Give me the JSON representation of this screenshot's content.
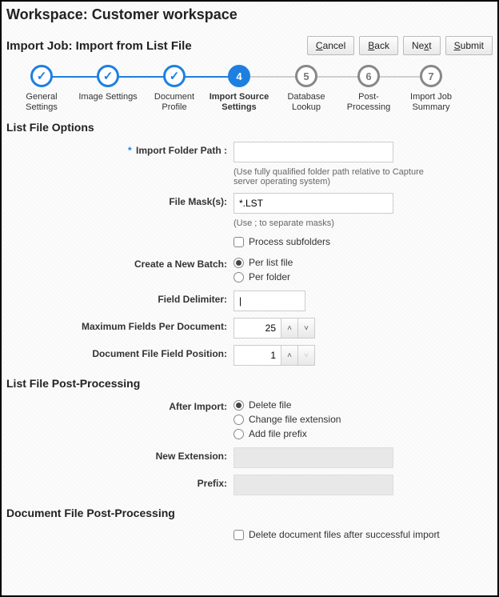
{
  "workspace_title": "Workspace: Customer workspace",
  "job_title": "Import Job: Import from List File",
  "buttons": {
    "cancel": "Cancel",
    "back": "Back",
    "next": "Next",
    "submit": "Submit"
  },
  "steps": [
    {
      "label": "General\nSettings",
      "state": "done"
    },
    {
      "label": "Image Settings",
      "state": "done"
    },
    {
      "label": "Document\nProfile",
      "state": "done"
    },
    {
      "num": "4",
      "label": "Import Source\nSettings",
      "state": "current"
    },
    {
      "num": "5",
      "label": "Database\nLookup",
      "state": "future"
    },
    {
      "num": "6",
      "label": "Post-\nProcessing",
      "state": "future"
    },
    {
      "num": "7",
      "label": "Import Job\nSummary",
      "state": "future"
    }
  ],
  "sections": {
    "listFileOptions": "List File Options",
    "listFilePost": "List File Post-Processing",
    "docFilePost": "Document File Post-Processing"
  },
  "form": {
    "importFolderPath": {
      "label": "Import Folder Path :",
      "value": "",
      "hint": "(Use fully qualified folder path relative to Capture server operating system)"
    },
    "fileMasks": {
      "label": "File Mask(s):",
      "value": "*.LST",
      "hint": "(Use ; to separate masks)"
    },
    "processSubfolders": {
      "label": "Process subfolders",
      "checked": false
    },
    "createNewBatch": {
      "label": "Create a New Batch:",
      "options": [
        "Per list file",
        "Per folder"
      ],
      "selected": 0
    },
    "fieldDelimiter": {
      "label": "Field Delimiter:",
      "value": "|"
    },
    "maxFields": {
      "label": "Maximum Fields Per Document:",
      "value": "25"
    },
    "docFieldPos": {
      "label": "Document File Field Position:",
      "value": "1"
    },
    "afterImport": {
      "label": "After Import:",
      "options": [
        "Delete file",
        "Change file extension",
        "Add file prefix"
      ],
      "selected": 0
    },
    "newExtension": {
      "label": "New Extension:",
      "value": ""
    },
    "prefix": {
      "label": "Prefix:",
      "value": ""
    },
    "deleteDocFiles": {
      "label": "Delete document files after successful import",
      "checked": false
    }
  }
}
